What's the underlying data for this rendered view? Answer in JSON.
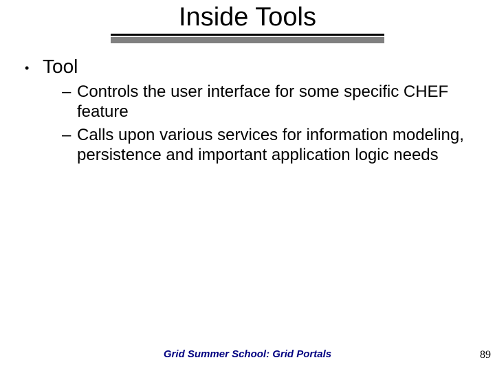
{
  "title": "Inside Tools",
  "bullets": {
    "lvl1": {
      "marker": "•",
      "text": "Tool"
    },
    "lvl2a": {
      "marker": "–",
      "text": "Controls the user interface for some specific CHEF feature"
    },
    "lvl2b": {
      "marker": "–",
      "text": "Calls upon various services for information modeling, persistence and important application logic needs"
    }
  },
  "footer": "Grid Summer School: Grid Portals",
  "page_number": "89"
}
